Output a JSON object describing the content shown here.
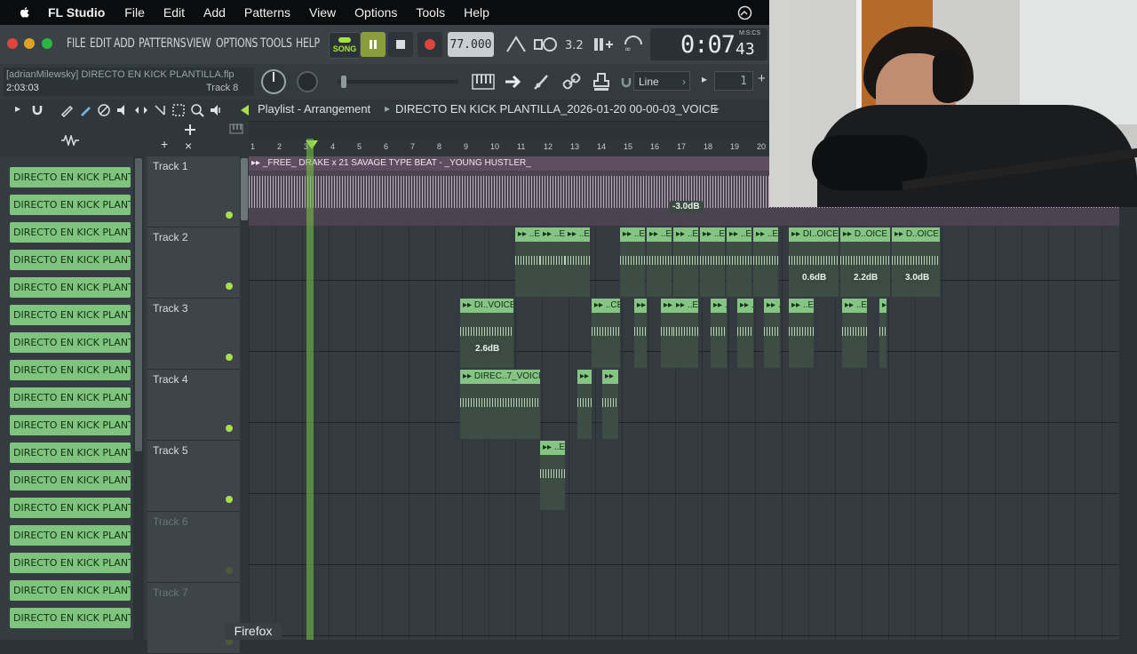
{
  "menubar": {
    "app": "FL Studio",
    "items": [
      "File",
      "Edit",
      "Add",
      "Patterns",
      "View",
      "Options",
      "Tools",
      "Help"
    ]
  },
  "fl": {
    "menu": [
      "FILE",
      "EDIT",
      "ADD",
      "PATTERNS",
      "VIEW",
      "OPTIONS",
      "TOOLS",
      "HELP"
    ],
    "song_label": "SONG",
    "tempo": "77.000",
    "time": "0:07",
    "time_small": "43",
    "time_unit": "M:S:CS",
    "project_file": "[adrianMilewsky] DIRECTO EN KICK PLANTILLA.flp",
    "position": "2:03:03",
    "hint_track": "Track 8",
    "snap": "Line",
    "step": "1"
  },
  "playlist": {
    "title": "Playlist - Arrangement",
    "path": "DIRECTO EN KICK PLANTILLA_2026-01-20 00-00-03_VOICE"
  },
  "picker_label": "DIRECTO EN KICK PLANTIL...",
  "tracks": [
    "Track 1",
    "Track 2",
    "Track 3",
    "Track 4",
    "Track 5",
    "Track 6",
    "Track 7"
  ],
  "ruler": [
    "1",
    "2",
    "3",
    "4",
    "5",
    "6",
    "7",
    "8",
    "9",
    "10",
    "11",
    "12",
    "13",
    "14",
    "15",
    "16",
    "17",
    "18",
    "19",
    "20"
  ],
  "clips": {
    "t1": "_FREE_ DRAKE x 21 SAVAGE TYPE BEAT - _YOUNG HUSTLER_",
    "t1_db": "-3.0dB",
    "t2_short": "..E",
    "t2_a": "DI..OICE",
    "t2_b": "D..OICE",
    "t2_c": "D..OICE",
    "t2_db1": "0.6dB",
    "t2_db2": "2.2dB",
    "t2_db3": "3.0dB",
    "t3_a": "DI..VOICE",
    "t3_db": "2.6dB",
    "t3_b": "..CE",
    "t4_a": "DIREC..7_VOICE"
  },
  "tooltip": "Firefox",
  "colors": {
    "clip": "#86c486",
    "playhead": "#78c846",
    "accent": "#a8e04a"
  }
}
